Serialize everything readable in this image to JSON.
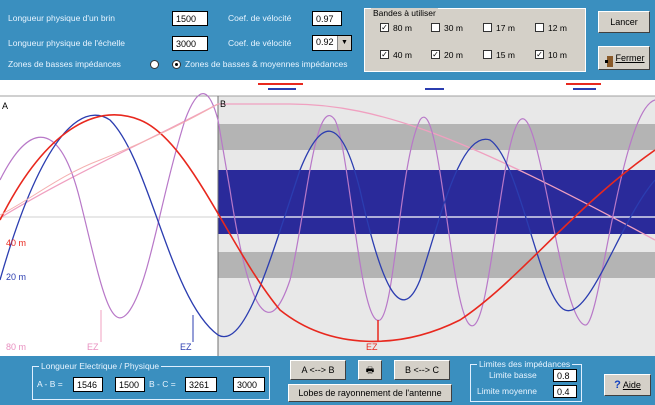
{
  "top": {
    "length_physical_strand_label": "Longueur physique d'un brin",
    "length_physical_strand_value": "1500",
    "length_physical_ladder_label": "Longueur physique de l'échelle",
    "length_physical_ladder_value": "3000",
    "velocity_coef_1_label": "Coef. de vélocité",
    "velocity_coef_1_value": "0.97",
    "velocity_coef_2_label": "Coef. de vélocité",
    "velocity_coef_2_value": "0.92",
    "radio_low_label": "Zones de basses impédances",
    "radio_high_label": "Zones de basses & moyennes impédances",
    "bands_title": "Bandes à utiliser",
    "bands": [
      {
        "label": "80 m",
        "checked": true
      },
      {
        "label": "30 m",
        "checked": false
      },
      {
        "label": "17 m",
        "checked": false
      },
      {
        "label": "12 m",
        "checked": false
      },
      {
        "label": "40 m",
        "checked": true
      },
      {
        "label": "20 m",
        "checked": true
      },
      {
        "label": "15 m",
        "checked": false
      },
      {
        "label": "10 m",
        "checked": true
      }
    ],
    "launch_label": "Lancer",
    "close_label": "Fermer"
  },
  "plot": {
    "marker_a": "A",
    "marker_b": "B",
    "label_40m": "40 m",
    "label_20m": "20 m",
    "label_80m": "80 m",
    "label_ez": "EZ",
    "colors": {
      "red": "#e8281e",
      "blue": "#2b3db0",
      "pink": "#e890c0",
      "violet": "#b878c8",
      "band_gray": "#b4b4b4",
      "band_navy": "#2a2a9a"
    }
  },
  "bottom": {
    "group_length_title": "Longueur Electrique / Physique",
    "ab_label": "A - B =",
    "ab_electric": "1546",
    "ab_physical": "1500",
    "bc_label": "B - C =",
    "bc_electric": "3261",
    "bc_physical": "3000",
    "ab_button": "A <--> B",
    "bc_button": "B <--> C",
    "lobes_button": "Lobes de rayonnement de l'antenne",
    "group_impedance_title": "Limites des impédances",
    "low_limit_label": "Limite basse",
    "low_limit_value": "0.8",
    "mid_limit_label": "Limite moyenne",
    "mid_limit_value": "0.4",
    "help_label": "Aide"
  }
}
